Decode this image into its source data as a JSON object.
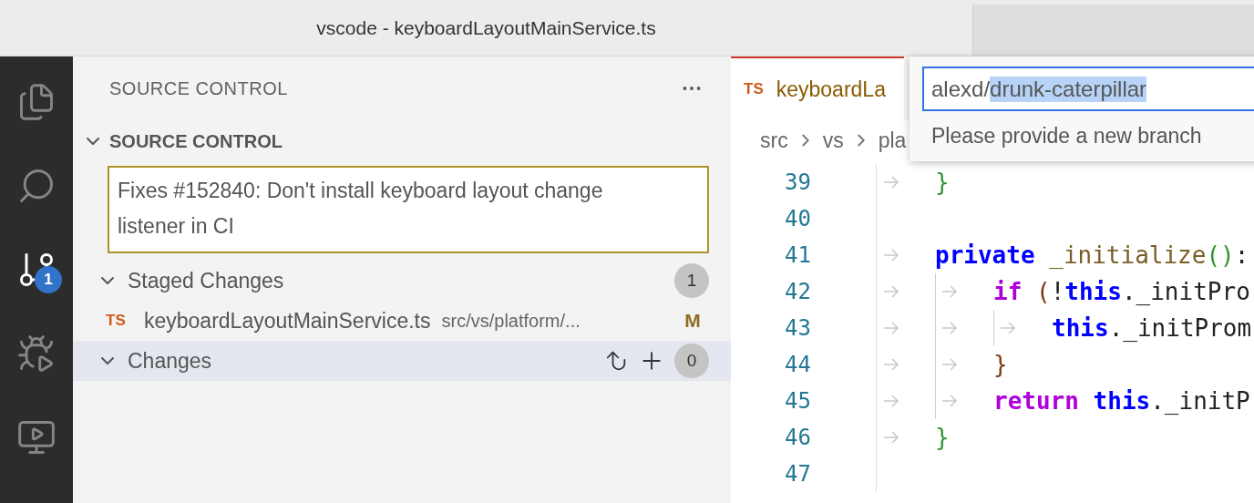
{
  "window": {
    "title": "vscode - keyboardLayoutMainService.ts"
  },
  "activity_bar": [
    {
      "kind": "explorer",
      "selected": false
    },
    {
      "kind": "search",
      "selected": false
    },
    {
      "kind": "source_control",
      "selected": true,
      "badge": "1"
    },
    {
      "kind": "run_debug",
      "selected": false
    },
    {
      "kind": "remote",
      "selected": false
    }
  ],
  "sidebar": {
    "title": "SOURCE CONTROL",
    "section": {
      "title": "SOURCE CONTROL",
      "expanded": true,
      "commit_message": "Fixes #152840: Don't install keyboard layout change listener in CI",
      "groups": [
        {
          "title": "Staged Changes",
          "expanded": true,
          "count": "1",
          "selected": false,
          "files": [
            {
              "icon": "TS",
              "name": "keyboardLayoutMainService.ts",
              "path": "src/vs/platform/...",
              "status": "M"
            }
          ]
        },
        {
          "title": "Changes",
          "expanded": true,
          "count": "0",
          "selected": true,
          "actions": [
            {
              "kind": "discard"
            },
            {
              "kind": "stage"
            }
          ]
        }
      ]
    }
  },
  "editor": {
    "tab": {
      "icon": "TS",
      "label": "keyboardLa",
      "selected": true
    },
    "breadcrumbs": [
      "src",
      "vs",
      "pla"
    ],
    "lines": [
      {
        "number": "39",
        "tokens": [
          {
            "kind": "tab"
          },
          {
            "kind": "bracket1",
            "text": "}"
          }
        ]
      },
      {
        "number": "40"
      },
      {
        "number": "41",
        "tokens": [
          {
            "kind": "tab"
          },
          {
            "kind": "keyword",
            "text": "private"
          },
          {
            "kind": "function",
            "text": " _initialize"
          },
          {
            "kind": "bracket1",
            "text": "()"
          },
          {
            "kind": "plain",
            "text": ":"
          }
        ]
      },
      {
        "number": "42",
        "tokens": [
          {
            "kind": "tab"
          },
          {
            "kind": "tab"
          },
          {
            "kind": "control",
            "text": "if"
          },
          {
            "kind": "bracket2",
            "text": " ("
          },
          {
            "kind": "plain",
            "text": "!"
          },
          {
            "kind": "keyword",
            "text": "this"
          },
          {
            "kind": "plain",
            "text": "._initPro"
          }
        ]
      },
      {
        "number": "43",
        "tokens": [
          {
            "kind": "tab"
          },
          {
            "kind": "tab"
          },
          {
            "kind": "tab"
          },
          {
            "kind": "keyword",
            "text": "this"
          },
          {
            "kind": "plain",
            "text": "._initProm"
          }
        ]
      },
      {
        "number": "44",
        "tokens": [
          {
            "kind": "tab"
          },
          {
            "kind": "tab"
          },
          {
            "kind": "bracket2",
            "text": "}"
          }
        ]
      },
      {
        "number": "45",
        "tokens": [
          {
            "kind": "tab"
          },
          {
            "kind": "tab"
          },
          {
            "kind": "control",
            "text": "return"
          },
          {
            "kind": "keyword",
            "text": " this"
          },
          {
            "kind": "plain",
            "text": "._initP"
          }
        ]
      },
      {
        "number": "46",
        "tokens": [
          {
            "kind": "tab"
          },
          {
            "kind": "bracket1",
            "text": "}"
          }
        ]
      },
      {
        "number": "47"
      }
    ]
  },
  "quick_input": {
    "value": "alexd/",
    "selected_text": "drunk-caterpillar",
    "message": "Please provide a new branch"
  }
}
